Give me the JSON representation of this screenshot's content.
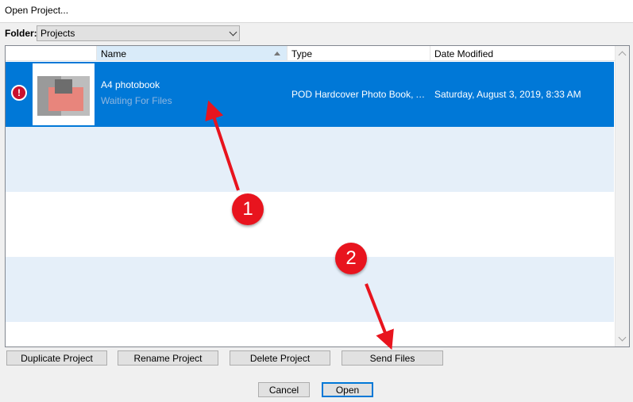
{
  "window": {
    "title": "Open Project..."
  },
  "folder": {
    "label": "Folder:",
    "value": "Projects"
  },
  "columns": {
    "name": "Name",
    "type": "Type",
    "date": "Date Modified"
  },
  "projects": [
    {
      "name": "A4 photobook",
      "status": "Waiting For Files",
      "type": "POD Hardcover Photo Book, A...",
      "date": "Saturday, August 3, 2019, 8:33 AM",
      "warning": "!"
    }
  ],
  "actions": {
    "duplicate": "Duplicate Project",
    "rename": "Rename Project",
    "delete": "Delete Project",
    "send": "Send Files"
  },
  "dialog": {
    "cancel": "Cancel",
    "open": "Open"
  },
  "annotations": {
    "one": "1",
    "two": "2"
  },
  "colors": {
    "selection": "#0078d7",
    "annotation": "#e8141e",
    "warning": "#c8102e"
  }
}
